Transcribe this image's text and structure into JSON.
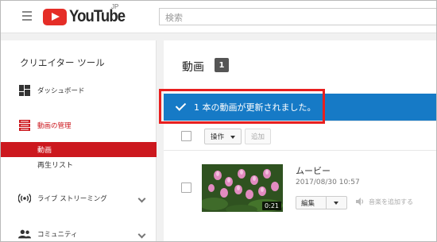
{
  "header": {
    "logo_text": "YouTube",
    "logo_region": "JP",
    "search_placeholder": "検索"
  },
  "sidebar": {
    "title": "クリエイター ツール",
    "items": [
      {
        "label": "ダッシュボード",
        "icon": "dashboard-icon"
      },
      {
        "label": "動画の管理",
        "icon": "video-manager-icon",
        "active": true
      },
      {
        "label": "ライブ ストリーミング",
        "icon": "live-stream-icon"
      },
      {
        "label": "コミュニティ",
        "icon": "community-icon"
      }
    ],
    "subitems": [
      {
        "label": "動画",
        "active": true
      },
      {
        "label": "再生リスト",
        "active": false
      }
    ]
  },
  "main": {
    "title": "動画",
    "count": "1",
    "notice": "1 本の動画が更新されました。",
    "toolbar": {
      "actions_label": "操作",
      "add_label": "追加"
    },
    "videos": [
      {
        "title": "ムービー",
        "date": "2017/08/30 10:57",
        "duration": "0:21",
        "edit_label": "編集",
        "music_label": "音楽を追加する"
      }
    ]
  },
  "colors": {
    "brand_red": "#e52d27",
    "active_red": "#cc181e",
    "notice_blue": "#167ac6",
    "highlight": "#e81f1f"
  }
}
